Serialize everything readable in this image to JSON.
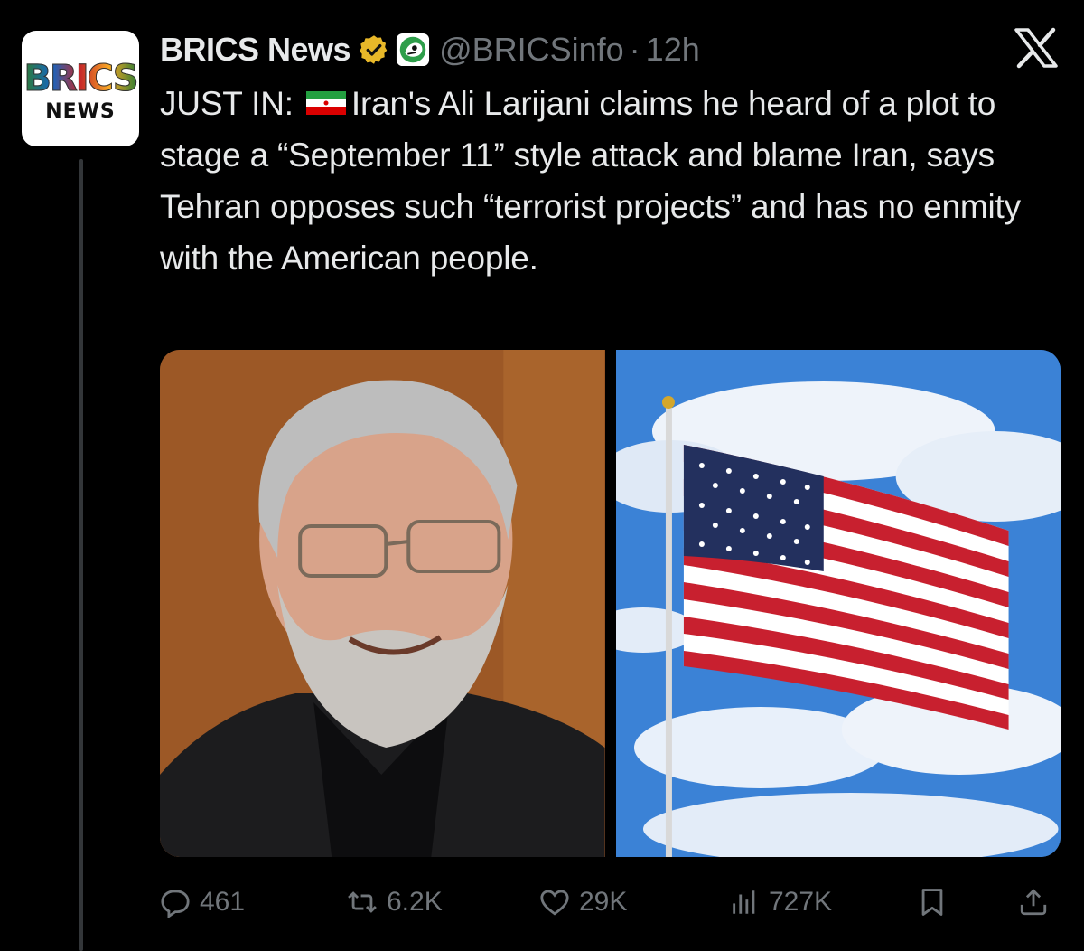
{
  "author": {
    "avatar_logo": "BRICS",
    "avatar_sub": "NEWS",
    "display_name": "BRICS News",
    "handle": "@BRICSinfo",
    "separator": "·",
    "time": "12h",
    "verified_badge_icon": "gold-check-badge-icon",
    "affiliate_icon": "affiliate-logo-icon"
  },
  "platform_icon": "x-logo-icon",
  "tweet": {
    "prefix": "JUST IN:",
    "flag_icon": "iran-flag-icon",
    "body": "Iran's Ali Larijani claims he heard of a plot to stage a “September 11” style attack and blame Iran, says Tehran opposes such “terrorist projects” and has no enmity with the American people."
  },
  "media": [
    {
      "icon": "portrait-photo-icon"
    },
    {
      "icon": "us-flag-photo-icon"
    }
  ],
  "actions": {
    "replies": "461",
    "reposts": "6.2K",
    "likes": "29K",
    "views": "727K"
  },
  "colors": {
    "background": "#000000",
    "text": "#e7e9ea",
    "muted": "#71767b",
    "badge_gold": "#e8b829"
  }
}
